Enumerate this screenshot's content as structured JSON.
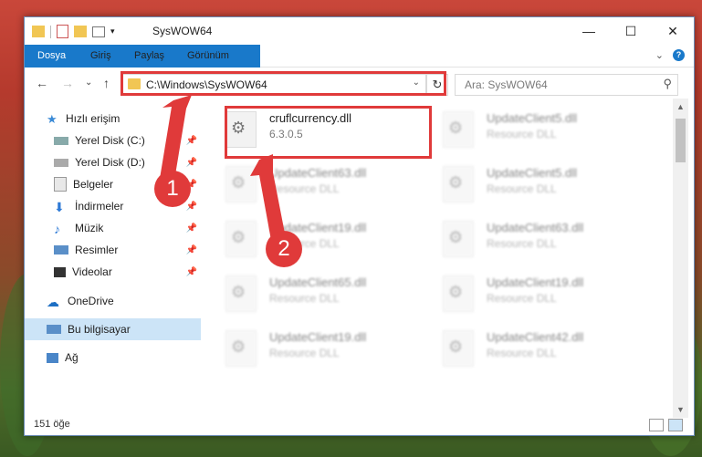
{
  "window": {
    "title": "SysWOW64",
    "controls": {
      "minimize": "—",
      "maximize": "☐",
      "close": "✕"
    }
  },
  "ribbon": {
    "tabs": [
      "Dosya",
      "Giriş",
      "Paylaş",
      "Görünüm"
    ],
    "expand": "⌄",
    "help": "?"
  },
  "navigation": {
    "back": "←",
    "forward": "→",
    "recent": "⌄",
    "up": "↑",
    "address": "C:\\Windows\\SysWOW64",
    "address_dropdown": "⌄",
    "refresh": "↻",
    "search_placeholder": "Ara: SysWOW64",
    "search_icon": "⚲"
  },
  "sidebar": {
    "quick_access": "Hızlı erişim",
    "items": [
      {
        "label": "Yerel Disk (C:)",
        "icon": "drive-icon",
        "pinned": true
      },
      {
        "label": "Yerel Disk (D:)",
        "icon": "drive-icon",
        "pinned": true
      },
      {
        "label": "Belgeler",
        "icon": "documents-icon",
        "pinned": true
      },
      {
        "label": "İndirmeler",
        "icon": "downloads-icon",
        "pinned": true
      },
      {
        "label": "Müzik",
        "icon": "music-icon",
        "pinned": true
      },
      {
        "label": "Resimler",
        "icon": "pictures-icon",
        "pinned": true
      },
      {
        "label": "Videolar",
        "icon": "videos-icon",
        "pinned": true
      }
    ],
    "onedrive": "OneDrive",
    "this_pc": "Bu bilgisayar",
    "network": "Ağ"
  },
  "files": [
    {
      "name": "cruflcurrency.dll",
      "desc": "6.3.0.5"
    },
    {
      "name": "UpdateClient5.dll",
      "desc": "Resource DLL"
    },
    {
      "name": "UpdateClient63.dll",
      "desc": "Resource DLL"
    },
    {
      "name": "UpdateClient5.dll",
      "desc": "Resource DLL"
    },
    {
      "name": "UpdateClient19.dll",
      "desc": "Resource DLL"
    },
    {
      "name": "UpdateClient63.dll",
      "desc": "Resource DLL"
    },
    {
      "name": "UpdateClient65.dll",
      "desc": "Resource DLL"
    },
    {
      "name": "UpdateClient19.dll",
      "desc": "Resource DLL"
    },
    {
      "name": "UpdateClient19.dll",
      "desc": "Resource DLL"
    },
    {
      "name": "UpdateClient42.dll",
      "desc": "Resource DLL"
    }
  ],
  "status": {
    "count": "151 öğe"
  },
  "annotations": {
    "marker1": "1",
    "marker2": "2",
    "color": "#e03a3a"
  },
  "colors": {
    "accent": "#1979ca",
    "selected": "#cce4f7"
  }
}
